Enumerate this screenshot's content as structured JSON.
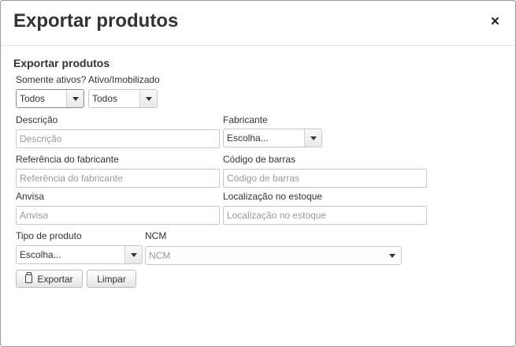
{
  "modal": {
    "title": "Exportar produtos",
    "close_symbol": "×"
  },
  "form": {
    "section_title": "Exportar produtos",
    "somente_ativos": {
      "label": "Somente ativos?",
      "value": "Todos"
    },
    "ativo_imobilizado": {
      "label": "Ativo/Imobilizado",
      "value": "Todos"
    },
    "descricao": {
      "label": "Descrição",
      "placeholder": "Descrição"
    },
    "fabricante": {
      "label": "Fabricante",
      "value": "Escolha..."
    },
    "referencia": {
      "label": "Referência do fabricante",
      "placeholder": "Referência do fabricante"
    },
    "codigo_barras": {
      "label": "Código de barras",
      "placeholder": "Código de barras"
    },
    "anvisa": {
      "label": "Anvisa",
      "placeholder": "Anvisa"
    },
    "localizacao": {
      "label": "Localização no estoque",
      "placeholder": "Localização no estoque"
    },
    "tipo_produto": {
      "label": "Tipo de produto",
      "value": "Escolha..."
    },
    "ncm": {
      "label": "NCM",
      "placeholder": "NCM"
    }
  },
  "buttons": {
    "exportar": {
      "label": "Exportar",
      "icon": "clipboard-icon"
    },
    "limpar": {
      "label": "Limpar"
    }
  }
}
